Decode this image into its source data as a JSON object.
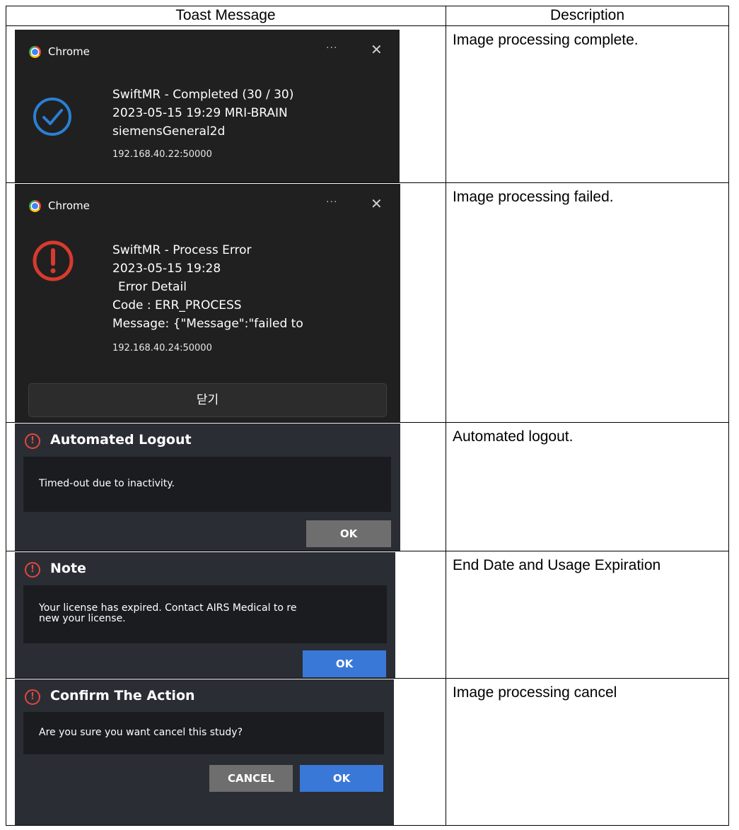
{
  "table": {
    "headers": [
      "Toast Message",
      "Description"
    ],
    "descriptions": [
      "Image processing complete.",
      "Image processing failed.",
      "Automated logout.",
      "End Date and Usage Expiration",
      "Image processing cancel"
    ]
  },
  "toast_complete": {
    "app_name": "Chrome",
    "more_icon": "···",
    "close_icon": "✕",
    "title": "SwiftMR - Completed (30 / 30)",
    "line2": "2023-05-15 19:29 MRI-BRAIN",
    "line3": "siemensGeneral2d",
    "source": "192.168.40.22:50000",
    "icon": "check-circle-icon",
    "icon_color": "#2a7fd4"
  },
  "toast_error": {
    "app_name": "Chrome",
    "more_icon": "···",
    "close_icon": "✕",
    "title": "SwiftMR - Process Error",
    "line2": "2023-05-15 19:28",
    "line3": "Error Detail",
    "line4": "Code : ERR_PROCESS",
    "line5": "Message: {\"Message\":\"failed to",
    "source": "192.168.40.24:50000",
    "close_button": "닫기",
    "icon": "error-circle-icon",
    "icon_color": "#d83a2e"
  },
  "dialog_logout": {
    "title": "Automated Logout",
    "message": "Timed-out due to inactivity.",
    "ok": "OK",
    "icon": "alert-circle-icon"
  },
  "dialog_note": {
    "title": "Note",
    "message_line1": "Your license has expired. Contact AIRS Medical to re",
    "message_line2": "new your license.",
    "ok": "OK",
    "icon": "alert-circle-icon"
  },
  "dialog_confirm": {
    "title": "Confirm The Action",
    "message": "Are you sure you want cancel this study?",
    "cancel": "CANCEL",
    "ok": "OK",
    "icon": "alert-circle-icon"
  },
  "colors": {
    "chrome_bg": "#202020",
    "dialog_bg": "#2b2d34",
    "dialog_body_bg": "#1b1c20",
    "button_gray": "#6e6e6e",
    "button_blue": "#3a78d8",
    "alert_red": "#e2483d"
  }
}
